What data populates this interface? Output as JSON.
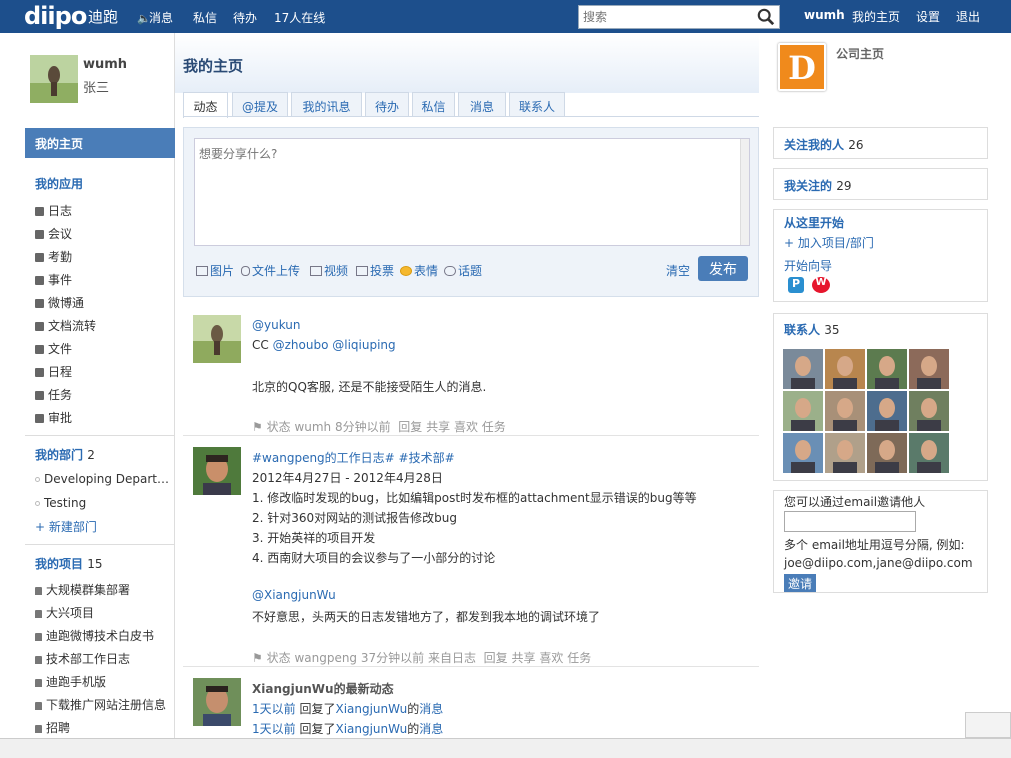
{
  "topbar": {
    "logo": "diipo",
    "logo_cn": "迪跑",
    "nav": [
      "消息",
      "私信",
      "待办",
      "17人在线"
    ],
    "search_placeholder": "搜索",
    "right_nav": [
      "wumh",
      "我的主页",
      "设置",
      "退出"
    ],
    "bg_color": "#1d4f8c"
  },
  "profile": {
    "username": "wumh",
    "realname": "张三"
  },
  "sidebar": {
    "home": "我的主页",
    "apps_title": "我的应用",
    "apps": [
      "日志",
      "会议",
      "考勤",
      "事件",
      "微博通",
      "文档流转",
      "文件",
      "日程",
      "任务",
      "审批"
    ],
    "dept_title": "我的部门",
    "dept_count": "2",
    "depts": [
      "Developing Departm...",
      "Testing"
    ],
    "new_dept": "+ 新建部门",
    "proj_title": "我的项目",
    "proj_count": "15",
    "projects": [
      "大规模群集部署",
      "大兴项目",
      "迪跑微博技术白皮书",
      "技术部工作日志",
      "迪跑手机版",
      "下载推广网站注册信息",
      "招聘"
    ]
  },
  "main": {
    "title": "我的主页",
    "tabs": [
      "动态",
      "@提及",
      "我的讯息",
      "待办",
      "私信",
      "消息",
      "联系人"
    ],
    "composer_placeholder": "想要分享什么?",
    "tools": [
      "图片",
      "文件上传",
      "视频",
      "投票",
      "表情",
      "话题"
    ],
    "clear": "清空",
    "publish": "发布"
  },
  "posts": [
    {
      "line1": "@yukun",
      "line2_prefix": "CC",
      "line2_mentions": [
        "@zhoubo",
        "@liqiuping"
      ],
      "body": "北京的QQ客服, 还是不能接受陌生人的消息.",
      "meta_state": "状态",
      "meta_user": "wumh",
      "meta_time": "8分钟以前",
      "actions": [
        "回复",
        "共享",
        "喜欢",
        "任务"
      ]
    },
    {
      "line1": "#wangpeng的工作日志# #技术部#",
      "date": "2012年4月27日 - 2012年4月28日",
      "items": [
        "1. 修改临时发现的bug，比如编辑post时发布框的attachment显示错误的bug等等",
        "2. 针对360对网站的测试报告修改bug",
        "3. 开始英祥的项目开发",
        "4. 西南财大项目的会议参与了一小部分的讨论"
      ],
      "mention": "@XiangjunWu",
      "body": "不好意思，头两天的日志发错地方了，都发到我本地的调试环境了",
      "meta_state": "状态",
      "meta_user": "wangpeng",
      "meta_time": "37分钟以前",
      "meta_from": "来自日志",
      "actions": [
        "回复",
        "共享",
        "喜欢",
        "任务"
      ]
    },
    {
      "title": "XiangjunWu的最新动态",
      "lines": [
        {
          "time": "1天以前",
          "mid": " 回复了",
          "user": "XiangjunWu",
          "suffix": "的",
          "link": "消息"
        },
        {
          "time": "1天以前",
          "mid": " 回复了",
          "user": "XiangjunWu",
          "suffix": "的",
          "link": "消息"
        }
      ]
    }
  ],
  "right": {
    "company": "公司主页",
    "company_logo_letter": "D",
    "followers_label": "关注我的人",
    "followers_count": "26",
    "following_label": "我关注的",
    "following_count": "29",
    "start_title": "从这里开始",
    "join_label": "+ 加入项目/部门",
    "guide_label": "开始向导",
    "contacts_label": "联系人",
    "contacts_count": "35",
    "invite_line1": "您可以通过email邀请他人",
    "invite_line2": "多个 email地址用逗号分隔, 例如:",
    "invite_line3": "joe@diipo.com,jane@diipo.com",
    "invite_btn": "邀请"
  }
}
